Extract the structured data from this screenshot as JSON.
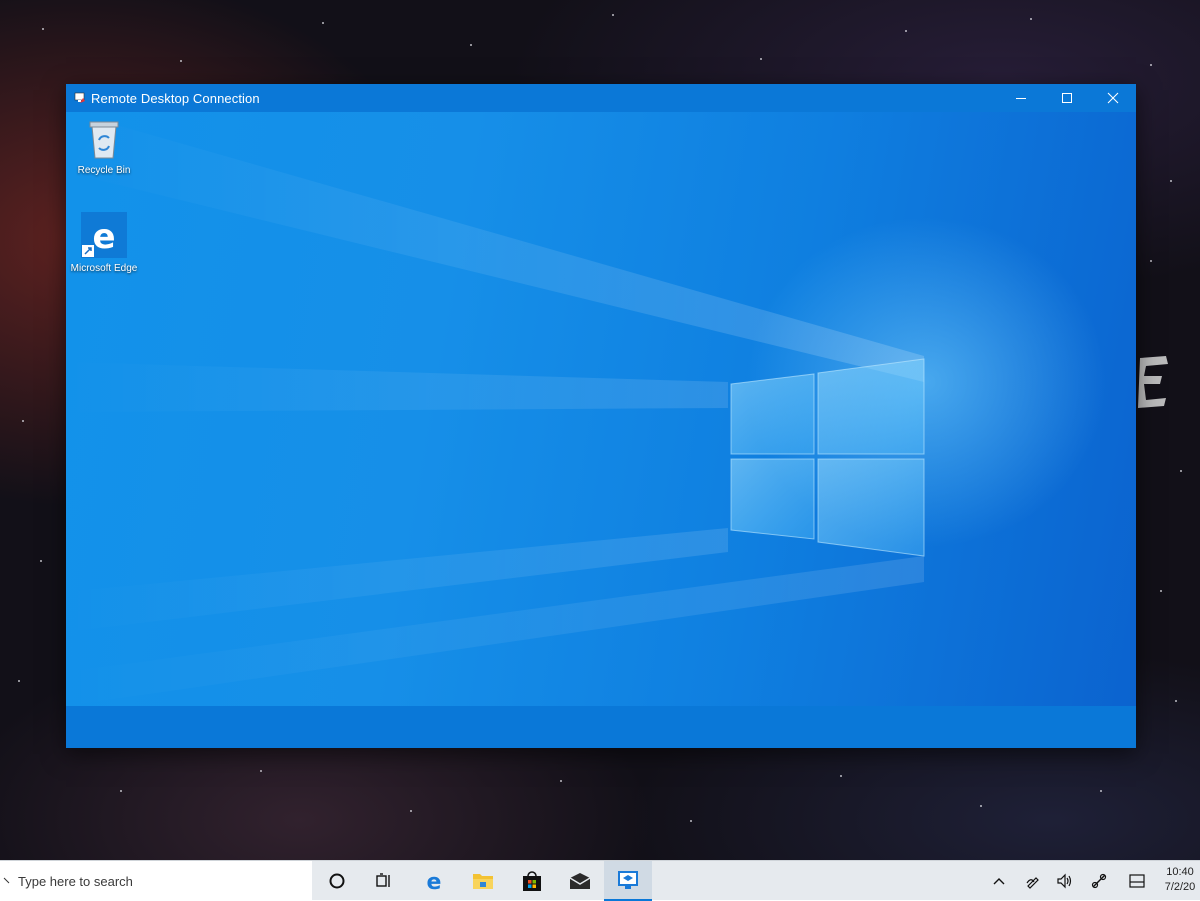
{
  "rdp_window": {
    "title": "Remote Desktop Connection",
    "controls": [
      "minimize",
      "maximize",
      "close"
    ]
  },
  "remote_desktop": {
    "icons": [
      {
        "label": "Recycle Bin",
        "icon": "recycle-bin-icon"
      },
      {
        "label": "Microsoft Edge",
        "icon": "edge-icon"
      }
    ]
  },
  "taskbar": {
    "search_placeholder": "Type here to search",
    "pinned": [
      "cortana-icon",
      "task-view-icon",
      "edge-icon",
      "file-explorer-icon",
      "store-icon",
      "mail-icon",
      "remote-desktop-icon"
    ],
    "active_app": "remote-desktop-icon",
    "tray": [
      "chevron-up-icon",
      "pen-icon",
      "volume-icon",
      "network-icon",
      "keyboard-icon"
    ],
    "clock": {
      "time": "10:40",
      "date": "7/2/20"
    }
  },
  "colors": {
    "accent": "#0078d7",
    "remote_wallpaper": "#1292ea",
    "taskbar_bg": "#e6eaee"
  }
}
